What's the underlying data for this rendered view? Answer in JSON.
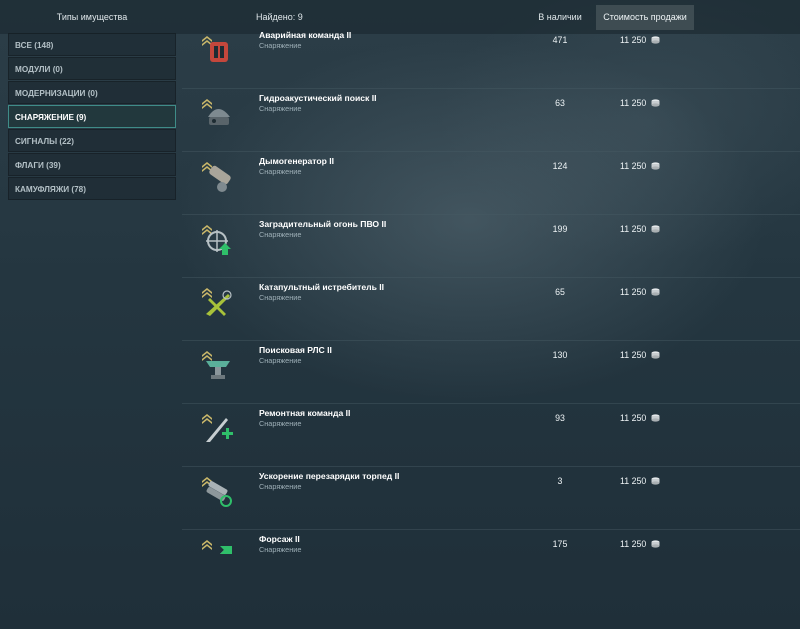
{
  "header": {
    "types_label": "Типы имущества",
    "found_label": "Найдено: 9",
    "stock_label": "В наличии",
    "price_label": "Стоимость продажи"
  },
  "categories": [
    {
      "label": "ВСЕ (148)"
    },
    {
      "label": "МОДУЛИ (0)"
    },
    {
      "label": "МОДЕРНИЗАЦИИ (0)"
    },
    {
      "label": "СНАРЯЖЕНИЕ (9)"
    },
    {
      "label": "СИГНАЛЫ (22)"
    },
    {
      "label": "ФЛАГИ (39)"
    },
    {
      "label": "КАМУФЛЯЖИ (78)"
    }
  ],
  "active_category": "СНАРЯЖЕНИЕ (9)",
  "coin_icon": "silver-coin-icon",
  "items": [
    {
      "name": "Аварийная команда II",
      "type": "Снаряжение",
      "stock": "471",
      "price": "11 250",
      "icon": "damage-control-icon",
      "color": "#c4473c"
    },
    {
      "name": "Гидроакустический поиск II",
      "type": "Снаряжение",
      "stock": "63",
      "price": "11 250",
      "icon": "hydroacoustic-icon",
      "color": "#7e8a90"
    },
    {
      "name": "Дымогенератор II",
      "type": "Снаряжение",
      "stock": "124",
      "price": "11 250",
      "icon": "smoke-generator-icon",
      "color": "#a9a59a"
    },
    {
      "name": "Заградительный огонь ПВО II",
      "type": "Снаряжение",
      "stock": "199",
      "price": "11 250",
      "icon": "defensive-aa-icon",
      "color": "#2fc06a"
    },
    {
      "name": "Катапультный истребитель II",
      "type": "Снаряжение",
      "stock": "65",
      "price": "11 250",
      "icon": "catapult-fighter-icon",
      "color": "#a8c23a"
    },
    {
      "name": "Поисковая РЛС II",
      "type": "Снаряжение",
      "stock": "130",
      "price": "11 250",
      "icon": "radar-icon",
      "color": "#5aaf9a"
    },
    {
      "name": "Ремонтная команда II",
      "type": "Снаряжение",
      "stock": "93",
      "price": "11 250",
      "icon": "repair-party-icon",
      "color": "#2fbf6a"
    },
    {
      "name": "Ускорение перезарядки торпед II",
      "type": "Снаряжение",
      "stock": "3",
      "price": "11 250",
      "icon": "torpedo-reload-icon",
      "color": "#2fbf6a"
    },
    {
      "name": "Форсаж II",
      "type": "Снаряжение",
      "stock": "175",
      "price": "11 250",
      "icon": "speed-boost-icon",
      "color": "#2fbf6a"
    }
  ]
}
